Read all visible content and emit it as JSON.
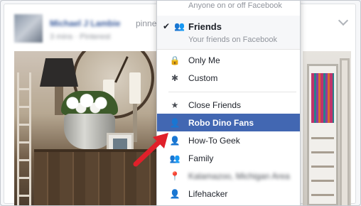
{
  "post": {
    "author": "Michael J Lambie",
    "action": "pinne",
    "meta": "3 mins · Pinterest"
  },
  "menu": {
    "top_hint": "Anyone on or off Facebook",
    "friends_title": "Friends",
    "friends_desc": "Your friends on Facebook",
    "only_me": "Only Me",
    "custom": "Custom",
    "lists": [
      {
        "label": "Close Friends",
        "icon": "star-icon"
      },
      {
        "label": "Robo Dino Fans",
        "icon": "person-list-icon",
        "selected": true
      },
      {
        "label": "How-To Geek",
        "icon": "person-list-icon"
      },
      {
        "label": "Family",
        "icon": "people-icon"
      },
      {
        "label": "Kalamazoo, Michigan Area",
        "icon": "location-icon"
      },
      {
        "label": "Lifehacker",
        "icon": "person-list-icon"
      }
    ]
  },
  "colors": {
    "accent": "#4267b2",
    "arrow": "#e0202a"
  }
}
